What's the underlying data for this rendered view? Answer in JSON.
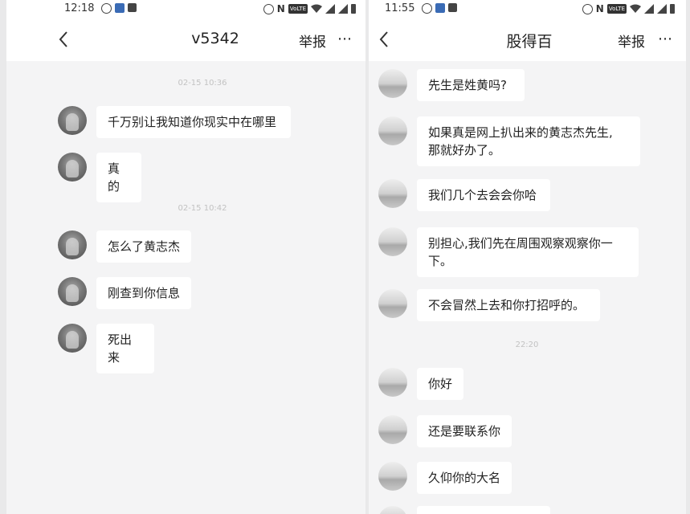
{
  "left_phone": {
    "status_bar": {
      "time": "12:18",
      "icons": [
        "location-icon",
        "app-icon",
        "image-icon",
        "alarm-icon",
        "nfc-icon",
        "volte-icon",
        "wifi-icon",
        "signal-icon",
        "signal-icon",
        "battery-icon"
      ],
      "volte": "VoLTE",
      "nfc": "N"
    },
    "nav": {
      "title": "v5342",
      "report_label": "举报",
      "more_glyph": "⋯"
    },
    "timestamps": [
      "02-15 10:36",
      "02-15 10:42"
    ],
    "messages": [
      "千万别让我知道你现实中在哪里",
      "真的",
      "怎么了黄志杰",
      "刚查到你信息",
      "死出来"
    ]
  },
  "right_phone": {
    "status_bar": {
      "time": "11:55",
      "volte": "VoLTE",
      "nfc": "N"
    },
    "nav": {
      "title": "股得百",
      "report_label": "举报",
      "more_glyph": "⋯"
    },
    "timestamps": [
      "22:20"
    ],
    "messages": [
      "先生是姓黄吗?",
      "如果真是网上扒出来的黄志杰先生,\n那就好办了。",
      "我们几个去会会你哈",
      "别担心,我们先在周围观察观察你一\n下。",
      "不会冒然上去和你打招呼的。",
      "你好",
      "还是要联系你",
      "久仰你的大名"
    ]
  },
  "colors": {
    "page_bg": "#f4f4f5",
    "bubble_bg": "#ffffff",
    "timestamp": "#c2c2c2",
    "volte_bg": "#333333"
  }
}
